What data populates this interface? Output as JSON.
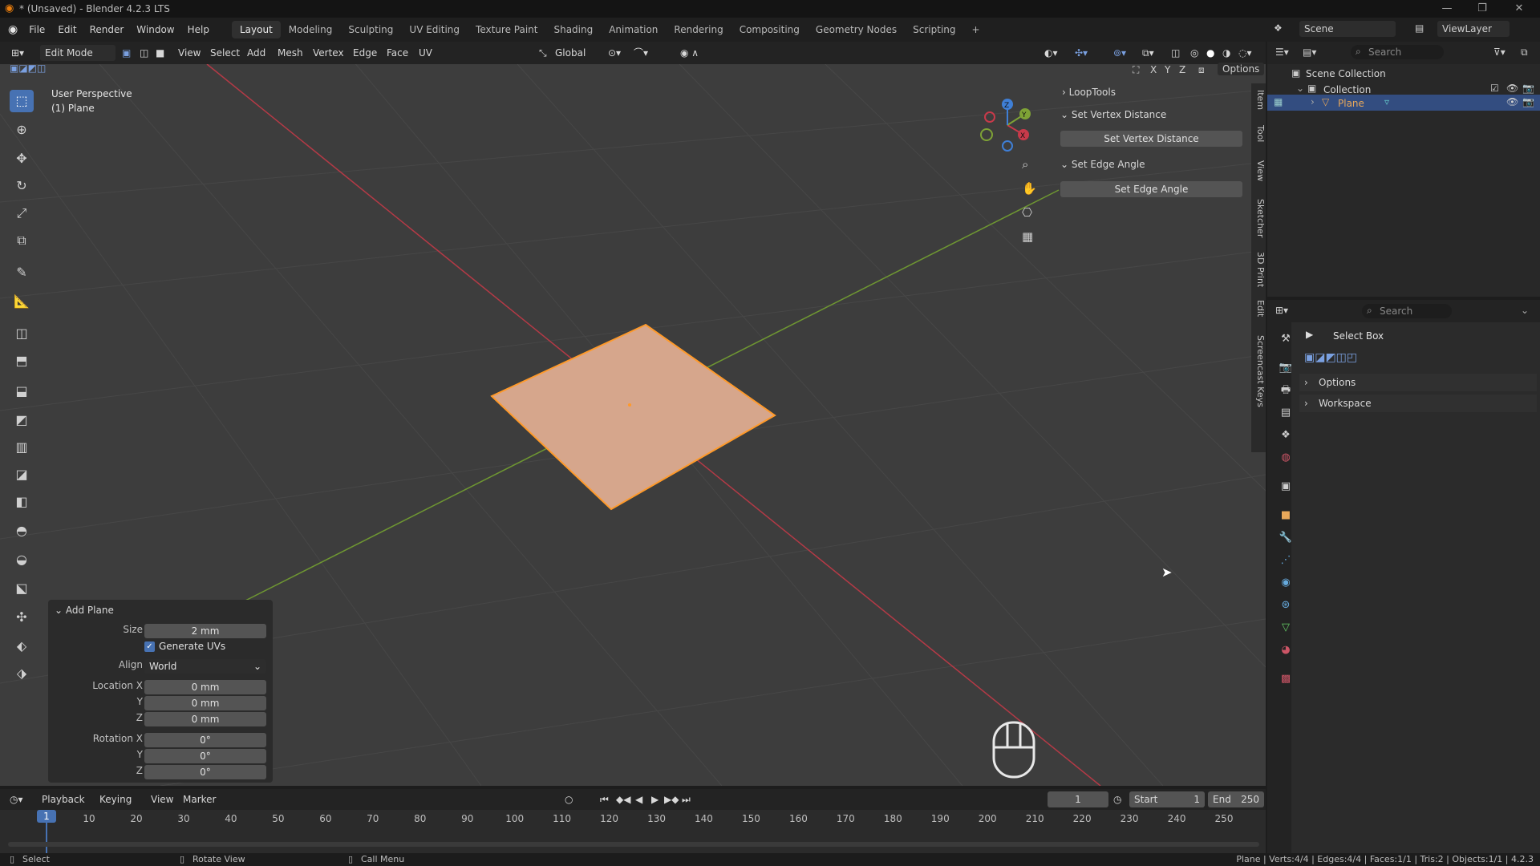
{
  "window": {
    "title": "* (Unsaved) - Blender 4.2.3 LTS",
    "controls": [
      "—",
      "❐",
      "✕"
    ]
  },
  "menubar": {
    "items": [
      "File",
      "Edit",
      "Render",
      "Window",
      "Help"
    ],
    "workspaces": [
      "Layout",
      "Modeling",
      "Sculpting",
      "UV Editing",
      "Texture Paint",
      "Shading",
      "Animation",
      "Rendering",
      "Compositing",
      "Geometry Nodes",
      "Scripting"
    ],
    "active_workspace": "Layout",
    "add_tab": "+",
    "scene_label": "Scene",
    "viewlayer_label": "ViewLayer"
  },
  "viewport_header": {
    "mode": "Edit Mode",
    "menus": [
      "View",
      "Select",
      "Add",
      "Mesh",
      "Vertex",
      "Edge",
      "Face",
      "UV"
    ],
    "transform_orientation": "Global",
    "axis_labels": [
      "X",
      "Y",
      "Z"
    ],
    "options_label": "Options"
  },
  "viewport": {
    "perspective_label": "User Perspective",
    "object_label": "(1) Plane",
    "gizmo_axes": [
      "X",
      "Y",
      "Z"
    ],
    "colors": {
      "background": "#3d3d3d",
      "x_axis": "#c83a4a",
      "y_axis": "#7ea236",
      "plane_face": "#d6a68c",
      "plane_edge": "#ff9a2a"
    }
  },
  "sidebar_panel": {
    "looptools": "LoopTools",
    "set_vertex_distance_header": "Set Vertex Distance",
    "set_vertex_distance_button": "Set Vertex Distance",
    "set_edge_angle_header": "Set Edge Angle",
    "set_edge_angle_button": "Set Edge Angle",
    "tabs": [
      "Item",
      "Tool",
      "View",
      "Sketcher",
      "3D Print",
      "Edit",
      "Screencast Keys"
    ]
  },
  "add_plane": {
    "title": "Add Plane",
    "size_label": "Size",
    "size_value": "2 mm",
    "generate_uvs_label": "Generate UVs",
    "generate_uvs_checked": true,
    "align_label": "Align",
    "align_value": "World",
    "location_label": "Location X",
    "location_x": "0 mm",
    "y_label": "Y",
    "location_y": "0 mm",
    "z_label": "Z",
    "location_z": "0 mm",
    "rotation_label": "Rotation X",
    "rotation_x": "0°",
    "rotation_y": "0°",
    "rotation_z": "0°"
  },
  "outliner": {
    "search_placeholder": "Search",
    "scene_collection": "Scene Collection",
    "collection": "Collection",
    "plane": "Plane"
  },
  "properties": {
    "search_placeholder": "Search",
    "tool_name": "Select Box",
    "options_label": "Options",
    "workspace_label": "Workspace"
  },
  "timeline": {
    "menus": [
      "Playback",
      "Keying",
      "View",
      "Marker"
    ],
    "current_frame": "1",
    "start_label": "Start",
    "start_value": "1",
    "end_label": "End",
    "end_value": "250",
    "ticks": [
      "1",
      "10",
      "20",
      "30",
      "40",
      "50",
      "60",
      "70",
      "80",
      "90",
      "100",
      "110",
      "120",
      "130",
      "140",
      "150",
      "160",
      "170",
      "180",
      "190",
      "200",
      "210",
      "220",
      "230",
      "240",
      "250"
    ]
  },
  "statusbar": {
    "select": "Select",
    "rotate_view": "Rotate View",
    "call_menu": "Call Menu",
    "stats": "Plane | Verts:4/4 | Edges:4/4 | Faces:1/1 | Tris:2 | Objects:1/1 | 4.2.3"
  }
}
